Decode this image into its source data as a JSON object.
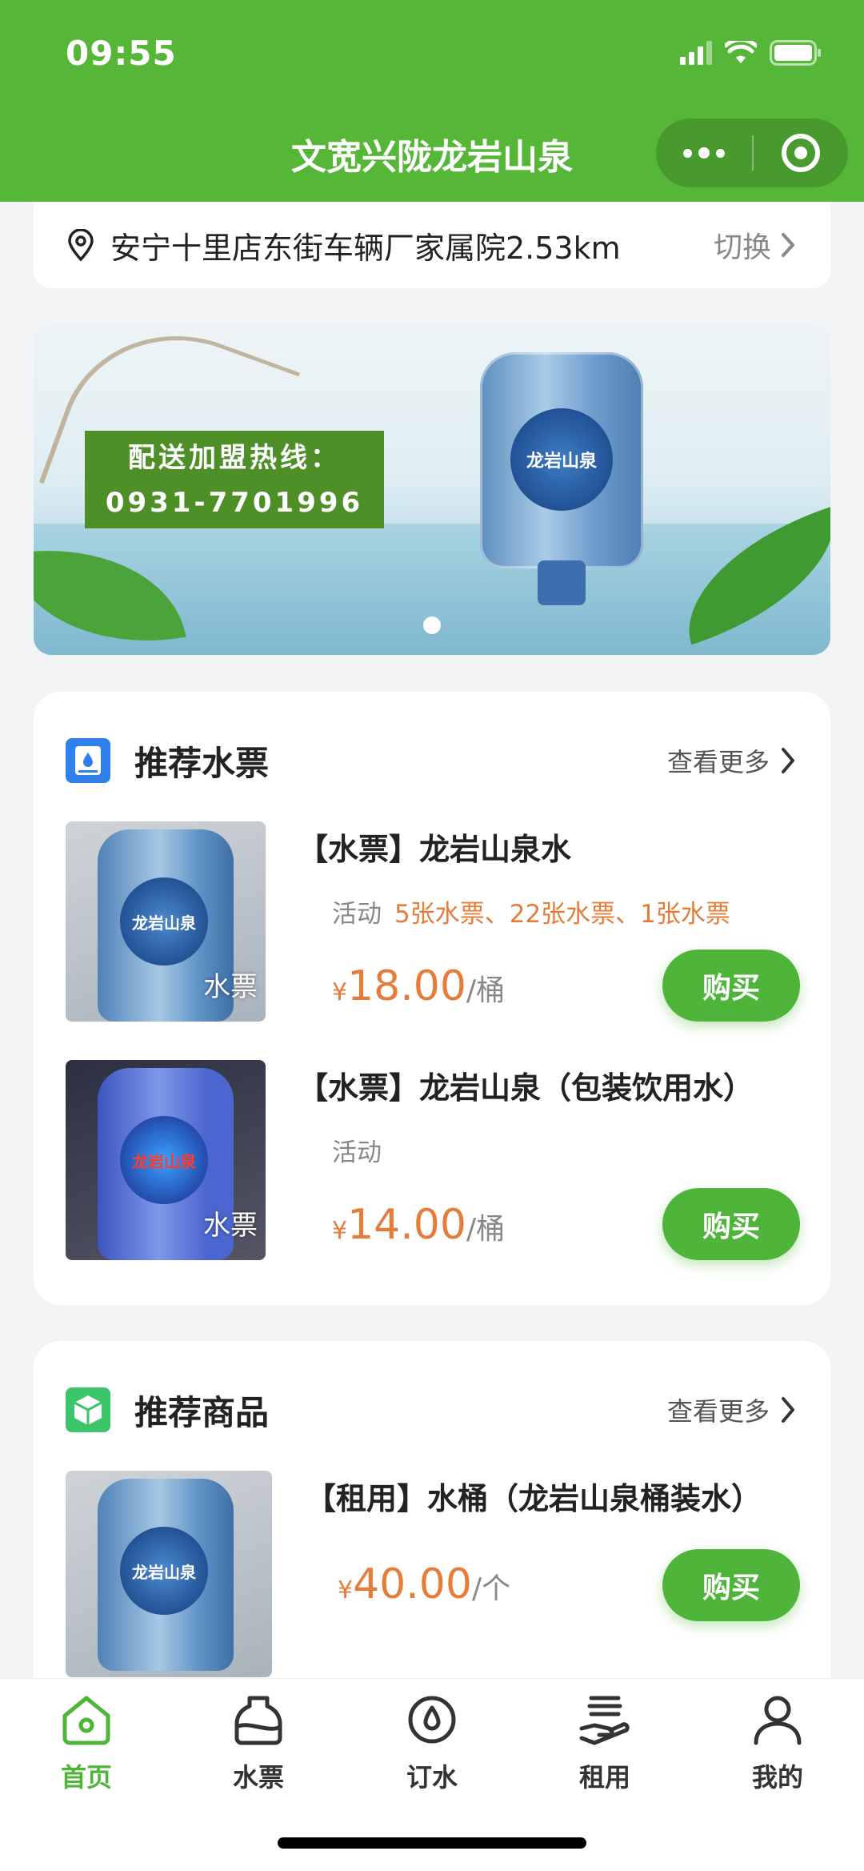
{
  "status_bar": {
    "time": "09:55"
  },
  "nav": {
    "title": "文宽兴陇龙岩山泉"
  },
  "location": {
    "address": "安宁十里店东街车辆厂家属院2.53km",
    "switch_label": "切换"
  },
  "banner": {
    "hotline_line1": "配送加盟热线：",
    "hotline_line2": "0931-7701996",
    "bottle_label": "龙岩山泉"
  },
  "recommended_tickets": {
    "title": "推荐水票",
    "more_label": "查看更多",
    "items": [
      {
        "name": "【水票】龙岩山泉水",
        "promo_label": "活动",
        "promo_value": "5张水票、22张水票、1张水票",
        "currency": "¥",
        "price": "18.00",
        "unit": "/桶",
        "tag": "水票",
        "thumb_label": "龙岩山泉",
        "buy_label": "购买"
      },
      {
        "name": "【水票】龙岩山泉（包装饮用水）",
        "promo_label": "活动",
        "promo_value": "",
        "currency": "¥",
        "price": "14.00",
        "unit": "/桶",
        "tag": "水票",
        "thumb_label": "龙岩山泉",
        "buy_label": "购买"
      }
    ]
  },
  "recommended_products": {
    "title": "推荐商品",
    "more_label": "查看更多",
    "items": [
      {
        "name": "【租用】水桶（龙岩山泉桶装水）",
        "currency": "¥",
        "price": "40.00",
        "unit": "/个",
        "thumb_label": "龙岩山泉",
        "buy_label": "购买"
      }
    ]
  },
  "tabbar": {
    "active": "首页",
    "tabs": [
      {
        "label": "首页",
        "icon": "home-icon"
      },
      {
        "label": "水票",
        "icon": "water-ticket-icon"
      },
      {
        "label": "订水",
        "icon": "order-water-icon"
      },
      {
        "label": "租用",
        "icon": "rent-icon"
      },
      {
        "label": "我的",
        "icon": "profile-icon"
      }
    ]
  },
  "colors": {
    "brand_green": "#55b637",
    "button_green": "#4fb53a",
    "price_orange": "#e67c3a"
  }
}
